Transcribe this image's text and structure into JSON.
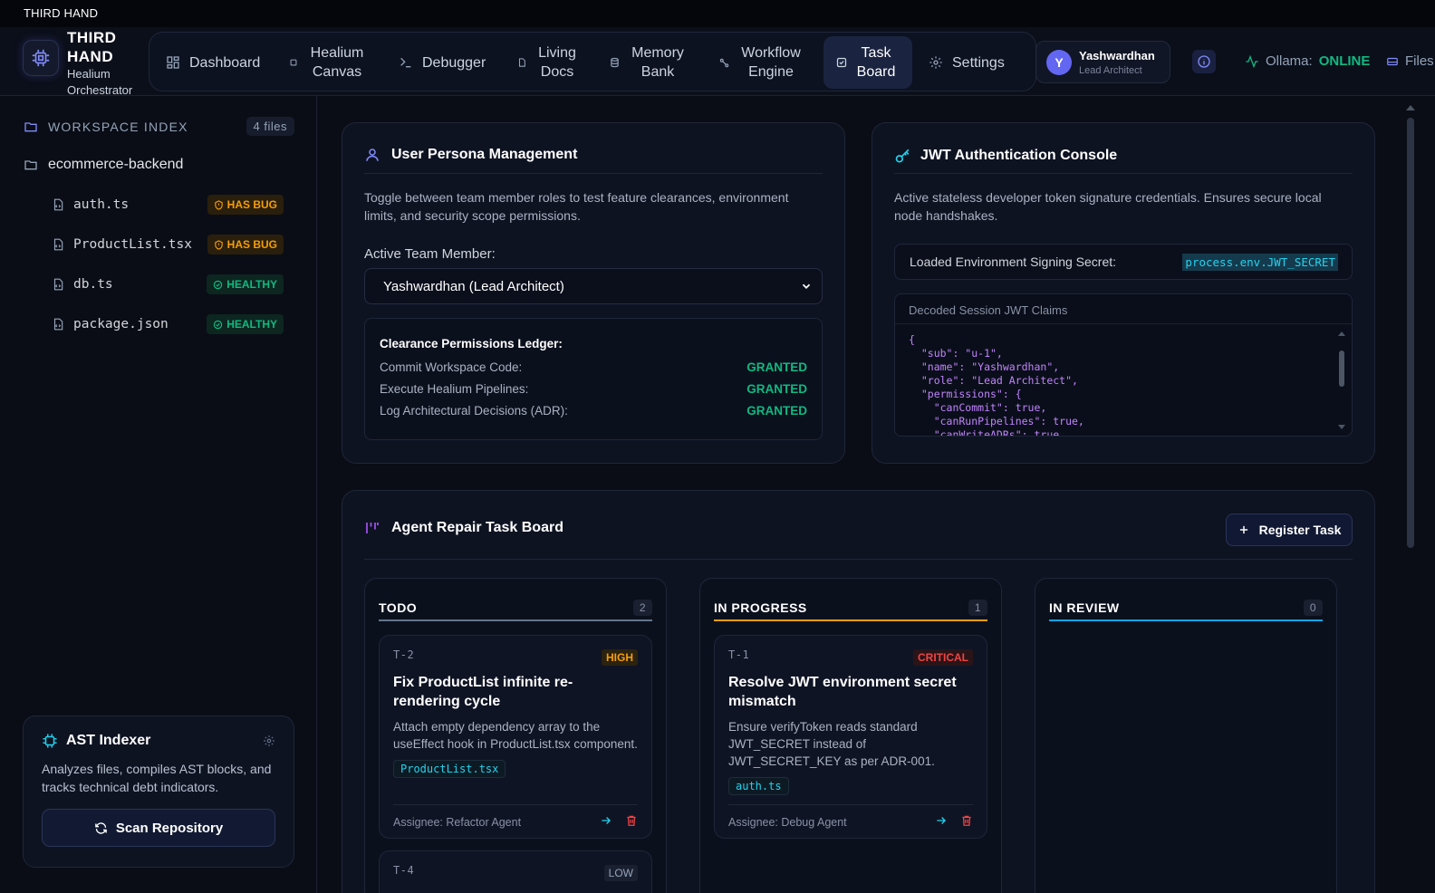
{
  "window": {
    "title": "THIRD HAND"
  },
  "brand": {
    "title": "THIRD HAND",
    "subtitle": "Healium Orchestrator"
  },
  "nav": {
    "items": [
      {
        "label": "Dashboard",
        "icon": "dashboard-icon"
      },
      {
        "label": "Healium Canvas",
        "icon": "canvas-icon"
      },
      {
        "label": "Debugger",
        "icon": "terminal-icon"
      },
      {
        "label": "Living Docs",
        "icon": "doc-icon"
      },
      {
        "label": "Memory Bank",
        "icon": "database-icon"
      },
      {
        "label": "Workflow Engine",
        "icon": "workflow-icon"
      },
      {
        "label": "Task Board",
        "icon": "task-icon",
        "active": true
      },
      {
        "label": "Settings",
        "icon": "gear-icon"
      }
    ]
  },
  "user": {
    "initial": "Y",
    "name": "Yashwardhan",
    "role": "Lead Architect"
  },
  "status": {
    "label": "Ollama:",
    "value": "ONLINE",
    "files_label": "Files:"
  },
  "sidebar": {
    "header": "WORKSPACE INDEX",
    "count": "4 files",
    "project": "ecommerce-backend",
    "files": [
      {
        "name": "auth.ts",
        "status": "HAS BUG"
      },
      {
        "name": "ProductList.tsx",
        "status": "HAS BUG"
      },
      {
        "name": "db.ts",
        "status": "HEALTHY"
      },
      {
        "name": "package.json",
        "status": "HEALTHY"
      }
    ],
    "ast": {
      "title": "AST Indexer",
      "desc": "Analyzes files, compiles AST blocks, and tracks technical debt indicators.",
      "button": "Scan Repository"
    }
  },
  "persona": {
    "title": "User Persona Management",
    "desc": "Toggle between team member roles to test feature clearances, environment limits, and security scope permissions.",
    "field_label": "Active Team Member:",
    "selected": "Yashwardhan (Lead Architect)",
    "ledger_title": "Clearance Permissions Ledger:",
    "ledger": [
      {
        "label": "Commit Workspace Code:",
        "value": "GRANTED"
      },
      {
        "label": "Execute Healium Pipelines:",
        "value": "GRANTED"
      },
      {
        "label": "Log Architectural Decisions (ADR):",
        "value": "GRANTED"
      }
    ]
  },
  "jwt": {
    "title": "JWT Authentication Console",
    "desc": "Active stateless developer token signature credentials. Ensures secure local node handshakes.",
    "secret_label": "Loaded Environment Signing Secret:",
    "secret_value": "process.env.JWT_SECRET",
    "claims_header": "Decoded Session JWT Claims",
    "claims_text": "{\n  \"sub\": \"u-1\",\n  \"name\": \"Yashwardhan\",\n  \"role\": \"Lead Architect\",\n  \"permissions\": {\n    \"canCommit\": true,\n    \"canRunPipelines\": true,\n    \"canWriteADRs\": true"
  },
  "board": {
    "title": "Agent Repair Task Board",
    "register_button": "Register Task",
    "columns": [
      {
        "title": "TODO",
        "count": "2",
        "color": "#64748b"
      },
      {
        "title": "IN PROGRESS",
        "count": "1",
        "color": "#f59e0b"
      },
      {
        "title": "IN REVIEW",
        "count": "0",
        "color": "#0ea5e9"
      }
    ],
    "cards": [
      {
        "id": "T-2",
        "priority": "HIGH",
        "title": "Fix ProductList infinite re-rendering cycle",
        "desc": "Attach empty dependency array to the useEffect hook in ProductList.tsx component.",
        "file": "ProductList.tsx",
        "assignee": "Assignee: Refactor Agent"
      },
      {
        "id": "T-1",
        "priority": "CRITICAL",
        "title": "Resolve JWT environment secret mismatch",
        "desc": "Ensure verifyToken reads standard JWT_SECRET instead of JWT_SECRET_KEY as per ADR-001.",
        "file": "auth.ts",
        "assignee": "Assignee: Debug Agent"
      },
      {
        "id": "T-4",
        "priority": "LOW"
      }
    ]
  }
}
